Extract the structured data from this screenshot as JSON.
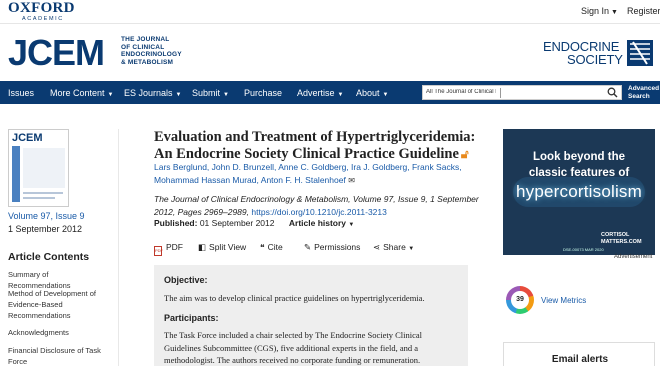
{
  "topbar": {
    "publisher": "OXFORD",
    "publisher_sub": "ACADEMIC",
    "sign_in": "Sign In",
    "register": "Register"
  },
  "header": {
    "journal_logo": "JCEM",
    "journal_full": [
      "THE JOURNAL",
      "OF CLINICAL",
      "ENDOCRINOLOGY",
      "& METABOLISM"
    ],
    "society": [
      "ENDOCRINE",
      "SOCIETY"
    ]
  },
  "nav": {
    "items": [
      "Issues",
      "More Content",
      "ES Journals",
      "Submit",
      "Purchase",
      "Advertise",
      "About"
    ],
    "search_scope": "All The Journal of Clinical E",
    "advanced_search": [
      "Advanced",
      "Search"
    ]
  },
  "sidebar": {
    "cover_title": "JCEM",
    "volume_issue": "Volume 97, Issue 9",
    "issue_date": "1 September 2012",
    "contents_title": "Article Contents",
    "toc": [
      "Summary of Recommendations",
      "Method of Development of Evidence-Based Recommendations",
      "Acknowledgments",
      "Financial Disclosure of Task Force"
    ]
  },
  "article": {
    "title": "Evaluation and Treatment of Hypertriglyceridemia: An Endocrine Society Clinical Practice Guideline",
    "authors": "Lars Berglund, John D. Brunzell, Anne C. Goldberg, Ira J. Goldberg, Frank Sacks, Mohammad Hassan Murad, Anton F. H. Stalenhoef",
    "citation": "The Journal of Clinical Endocrinology & Metabolism, Volume 97, Issue 9, 1 September 2012, Pages 2969–2989,",
    "doi": "https://doi.org/10.1210/jc.2011-3213",
    "published_label": "Published:",
    "published_date": "01 September 2012",
    "history_label": "Article history",
    "tools": [
      "PDF",
      "Split View",
      "Cite",
      "Permissions",
      "Share"
    ]
  },
  "abstract": {
    "objective_heading": "Objective:",
    "objective_text": "The aim was to develop clinical practice guidelines on hypertriglyceridemia.",
    "participants_heading": "Participants:",
    "participants_text": "The Task Force included a chair selected by The Endocrine Society Clinical Guidelines Subcommittee (CGS), five additional experts in the field, and a methodologist. The authors received no corporate funding or remuneration."
  },
  "ad": {
    "line1": "Look beyond the",
    "line2": "classic features of",
    "line3": "hypercortisolism",
    "brand": [
      "CORTISOL",
      "MATTERS.COM"
    ],
    "fine": "DSE-00073 MAR 2020",
    "label": "Advertisement"
  },
  "metrics": {
    "altmetric_score": "39",
    "view_metrics": "View Metrics"
  },
  "email_alerts": "Email alerts",
  "colors": {
    "brand_navy": "#0a3a71",
    "link_blue": "#1a5ba8",
    "open_access_orange": "#e8891b"
  }
}
